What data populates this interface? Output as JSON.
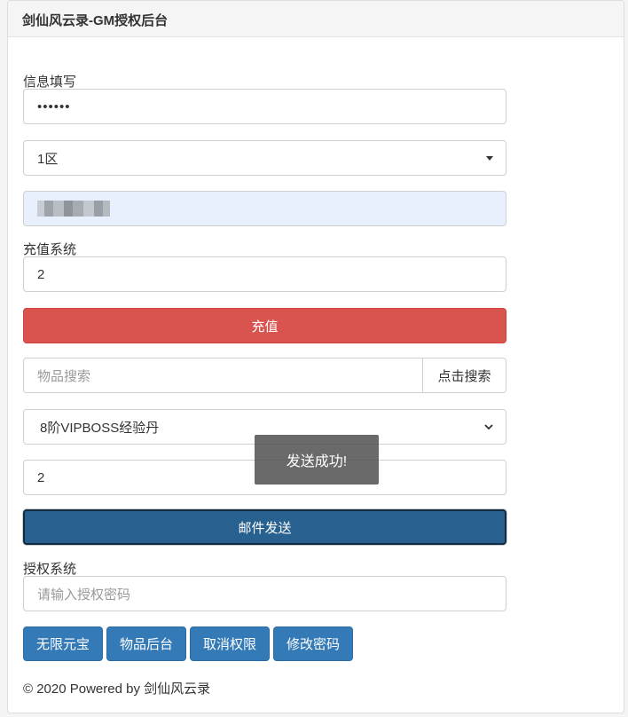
{
  "header": {
    "title": "剑仙风云录-GM授权后台"
  },
  "info": {
    "label": "信息填写",
    "password_value": "••••••",
    "server_selected": "1区"
  },
  "recharge": {
    "label": "充值系统",
    "amount_value": "2",
    "button_label": "充值"
  },
  "item": {
    "search_placeholder": "物品搜索",
    "search_button": "点击搜索",
    "selected_item": "8阶VIPBOSS经验丹",
    "quantity_value": "2",
    "send_button": "邮件发送"
  },
  "toast": {
    "message": "发送成功!"
  },
  "auth": {
    "label": "授权系统",
    "password_placeholder": "请输入授权密码",
    "buttons": [
      "无限元宝",
      "物品后台",
      "取消权限",
      "修改密码"
    ]
  },
  "footer": {
    "text": "© 2020 Powered by 剑仙风云录"
  },
  "colors": {
    "danger": "#d9534f",
    "primary": "#337ab7",
    "primary_dark": "#286090",
    "autofill": "#e8f0fe"
  }
}
